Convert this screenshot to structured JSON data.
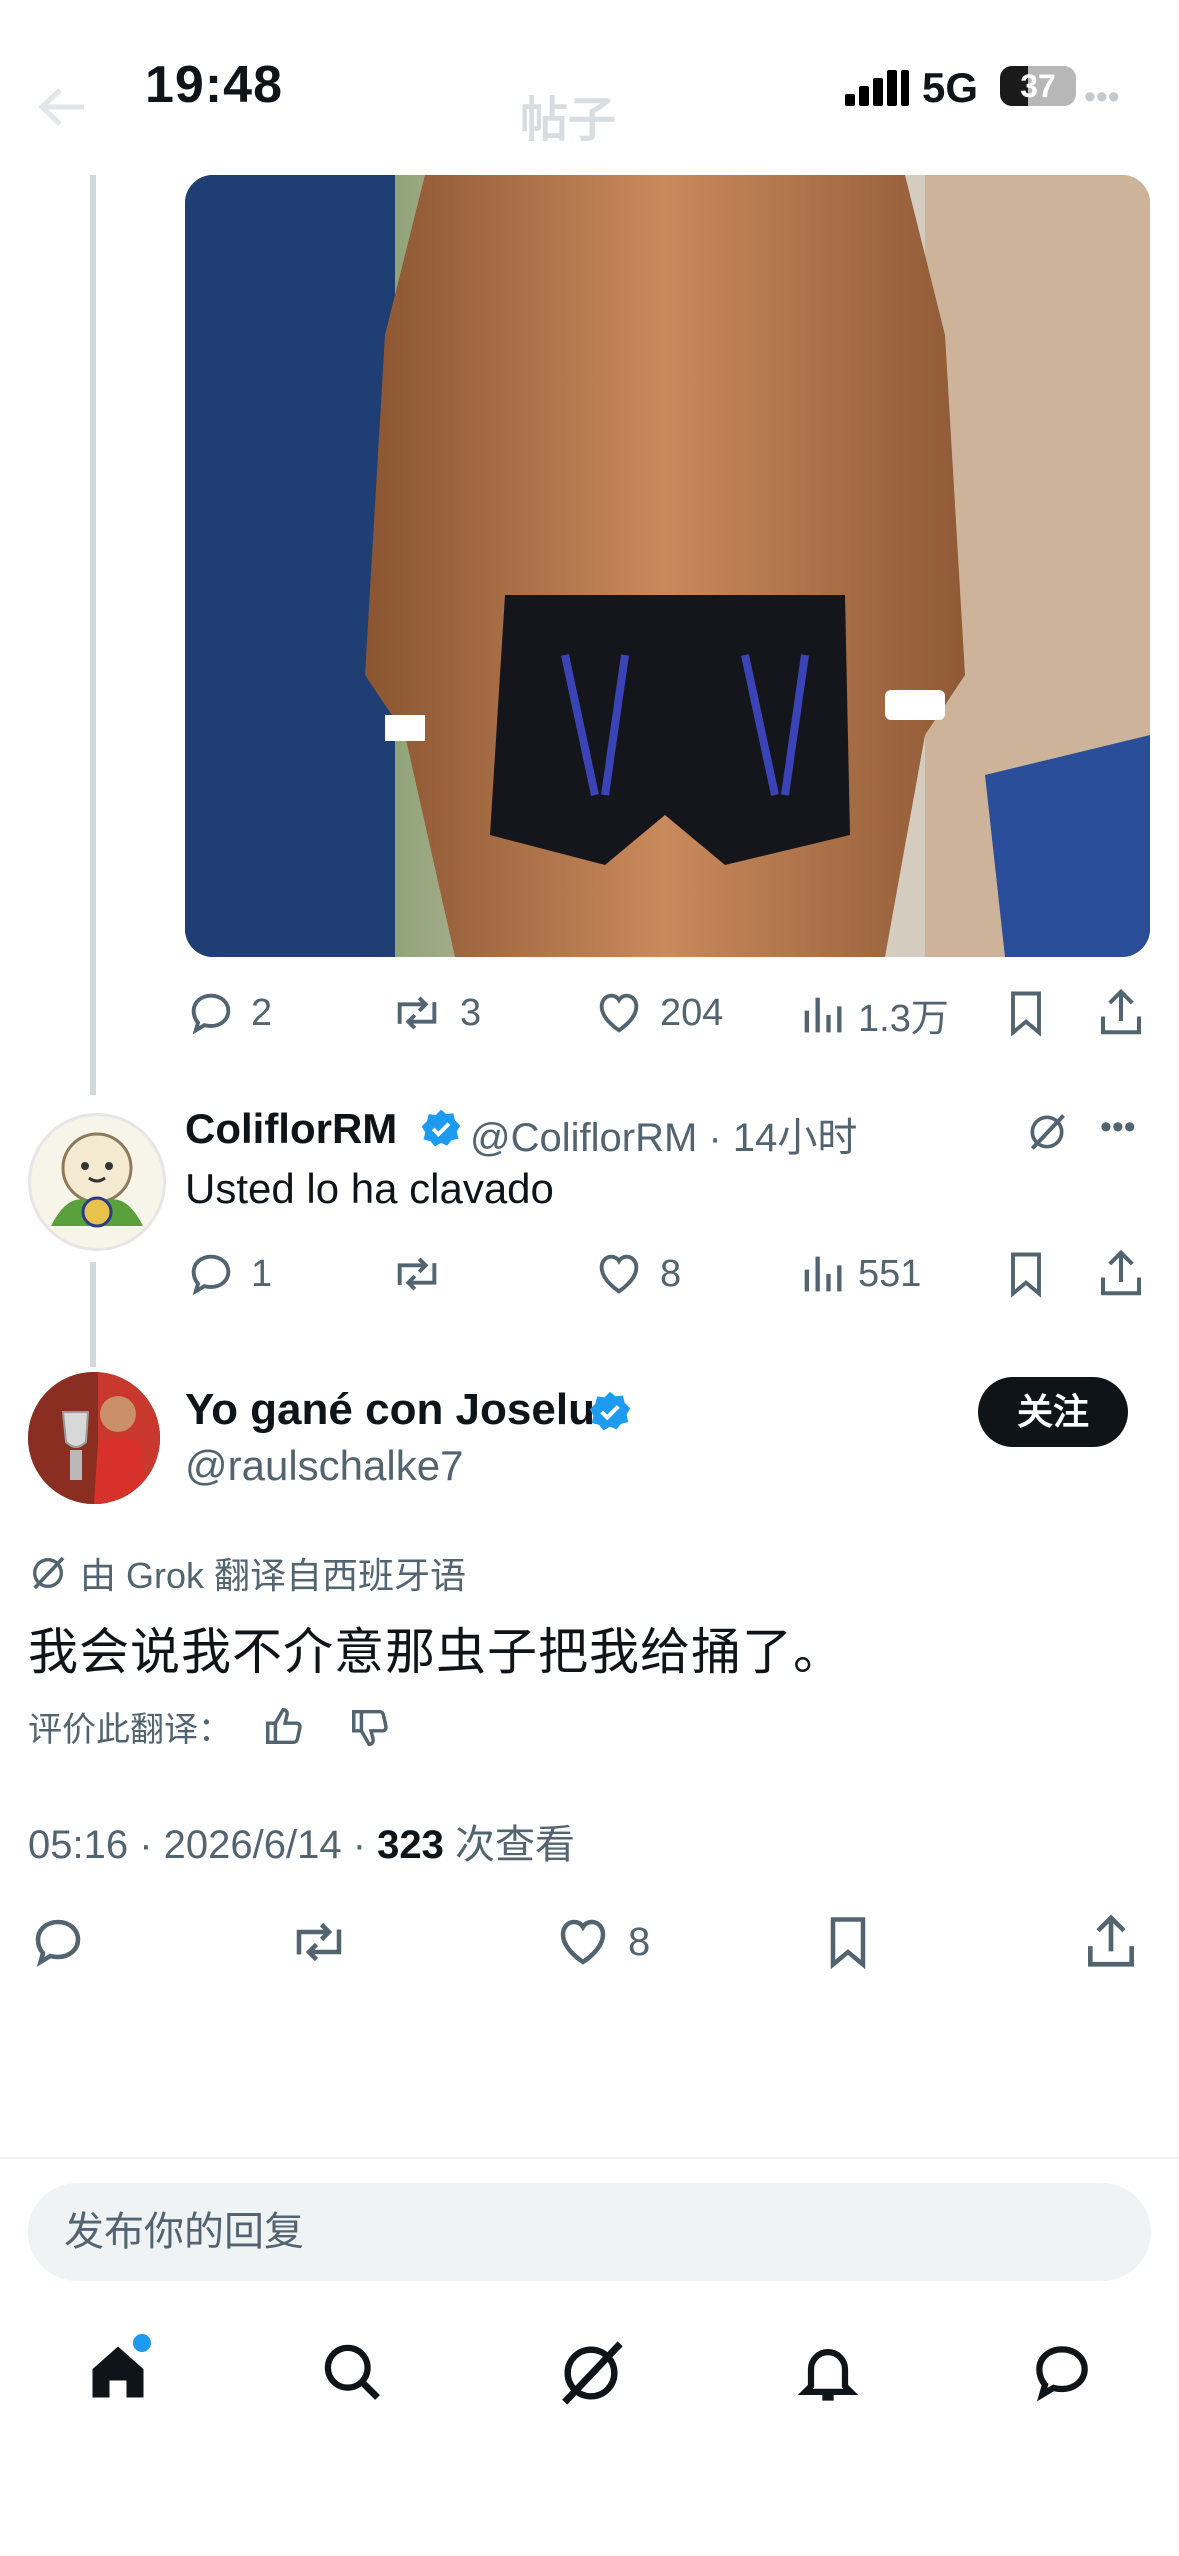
{
  "status_bar": {
    "time": "19:48",
    "network": "5G",
    "battery": "37"
  },
  "nav": {
    "title": "帖子"
  },
  "thread_top_actions": {
    "replies": "2",
    "reposts": "3",
    "likes": "204",
    "views": "1.3万"
  },
  "reply": {
    "name": "ColiflorRM",
    "handle": "@ColiflorRM",
    "time": "14小时",
    "handle_time": "@ColiflorRM · 14小时",
    "text": "Usted lo ha clavado",
    "replies": "1",
    "reposts": "",
    "likes": "8",
    "views": "551"
  },
  "main_tweet": {
    "name": "Yo gané con Joselu",
    "handle": "@raulschalke7",
    "follow_label": "关注",
    "translated_by": "由 Grok 翻译自西班牙语",
    "text": "我会说我不介意那虫子把我给捅了。",
    "rate_label": "评价此翻译：",
    "time_date": "05:16 · 2026/6/14 · ",
    "views_count": "323",
    "views_label": " 次查看",
    "likes": "8"
  },
  "reply_box": {
    "placeholder": "发布你的回复"
  },
  "tabs": [
    "home",
    "search",
    "grok",
    "notifications",
    "messages"
  ],
  "colors": {
    "accent": "#1d9bf0",
    "text": "#0f1419",
    "muted": "#536471",
    "line": "#cfd9de"
  }
}
